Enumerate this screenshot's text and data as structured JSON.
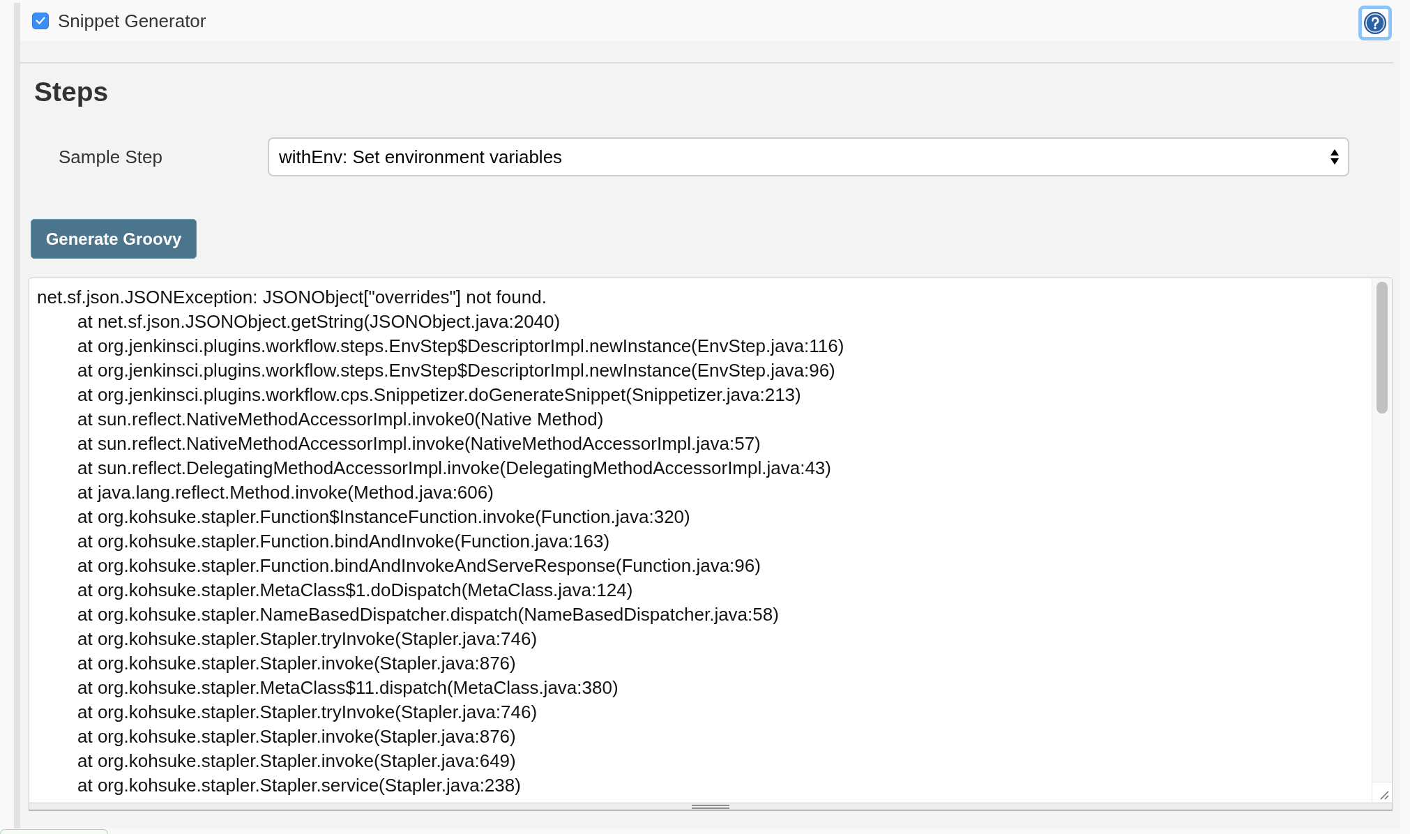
{
  "section": {
    "title": "Snippet Generator",
    "checked": true
  },
  "steps": {
    "heading": "Steps",
    "sample_step": {
      "label": "Sample Step",
      "value": "withEnv: Set environment variables"
    },
    "generate_button": "Generate Groovy",
    "output": {
      "exception": "net.sf.json.JSONException: JSONObject[\"overrides\"] not found.",
      "frames": [
        "at net.sf.json.JSONObject.getString(JSONObject.java:2040)",
        "at org.jenkinsci.plugins.workflow.steps.EnvStep$DescriptorImpl.newInstance(EnvStep.java:116)",
        "at org.jenkinsci.plugins.workflow.steps.EnvStep$DescriptorImpl.newInstance(EnvStep.java:96)",
        "at org.jenkinsci.plugins.workflow.cps.Snippetizer.doGenerateSnippet(Snippetizer.java:213)",
        "at sun.reflect.NativeMethodAccessorImpl.invoke0(Native Method)",
        "at sun.reflect.NativeMethodAccessorImpl.invoke(NativeMethodAccessorImpl.java:57)",
        "at sun.reflect.DelegatingMethodAccessorImpl.invoke(DelegatingMethodAccessorImpl.java:43)",
        "at java.lang.reflect.Method.invoke(Method.java:606)",
        "at org.kohsuke.stapler.Function$InstanceFunction.invoke(Function.java:320)",
        "at org.kohsuke.stapler.Function.bindAndInvoke(Function.java:163)",
        "at org.kohsuke.stapler.Function.bindAndInvokeAndServeResponse(Function.java:96)",
        "at org.kohsuke.stapler.MetaClass$1.doDispatch(MetaClass.java:124)",
        "at org.kohsuke.stapler.NameBasedDispatcher.dispatch(NameBasedDispatcher.java:58)",
        "at org.kohsuke.stapler.Stapler.tryInvoke(Stapler.java:746)",
        "at org.kohsuke.stapler.Stapler.invoke(Stapler.java:876)",
        "at org.kohsuke.stapler.MetaClass$11.dispatch(MetaClass.java:380)",
        "at org.kohsuke.stapler.Stapler.tryInvoke(Stapler.java:746)",
        "at org.kohsuke.stapler.Stapler.invoke(Stapler.java:876)",
        "at org.kohsuke.stapler.Stapler.invoke(Stapler.java:649)",
        "at org.kohsuke.stapler.Stapler.service(Stapler.java:238)"
      ]
    }
  }
}
